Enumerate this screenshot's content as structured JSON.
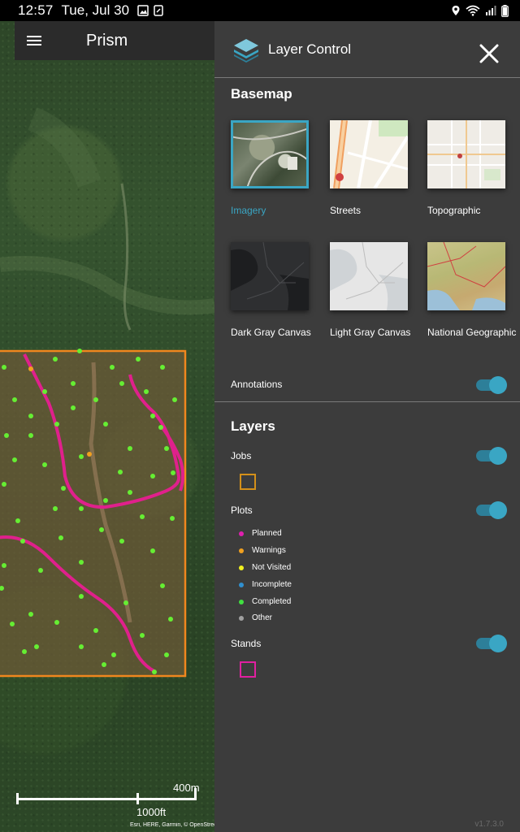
{
  "status_bar": {
    "time": "12:57",
    "date": "Tue, Jul 30"
  },
  "app_bar": {
    "title": "Prism",
    "menu_icon": "menu-icon"
  },
  "map": {
    "scale_top_label": "400m",
    "scale_bottom_label": "1000ft",
    "attribution": "Esri, HERE, Garmin, © OpenStreetMap"
  },
  "panel": {
    "title": "Layer Control",
    "basemap_section": "Basemap",
    "basemaps": [
      {
        "label": "Imagery",
        "selected": true
      },
      {
        "label": "Streets",
        "selected": false
      },
      {
        "label": "Topographic",
        "selected": false
      },
      {
        "label": "Dark Gray Canvas",
        "selected": false
      },
      {
        "label": "Light Gray Canvas",
        "selected": false
      },
      {
        "label": "National Geographic",
        "selected": false
      }
    ],
    "annotations_label": "Annotations",
    "annotations_on": true,
    "layers_section": "Layers",
    "jobs_label": "Jobs",
    "jobs_on": true,
    "jobs_color": "#d4901a",
    "plots_label": "Plots",
    "plots_on": true,
    "plot_legend": [
      {
        "label": "Planned",
        "color": "#e020b0"
      },
      {
        "label": "Warnings",
        "color": "#f0a020"
      },
      {
        "label": "Not Visited",
        "color": "#f0f020"
      },
      {
        "label": "Incomplete",
        "color": "#3090d0"
      },
      {
        "label": "Completed",
        "color": "#40e040"
      },
      {
        "label": "Other",
        "color": "#a0a0a0"
      }
    ],
    "stands_label": "Stands",
    "stands_on": true,
    "stands_color": "#e020a0",
    "version": "v1.7.3.0"
  },
  "colors": {
    "accent": "#3aa6c4",
    "panel_bg": "#3c3c3c",
    "app_bar_bg": "#2b2b2b"
  }
}
